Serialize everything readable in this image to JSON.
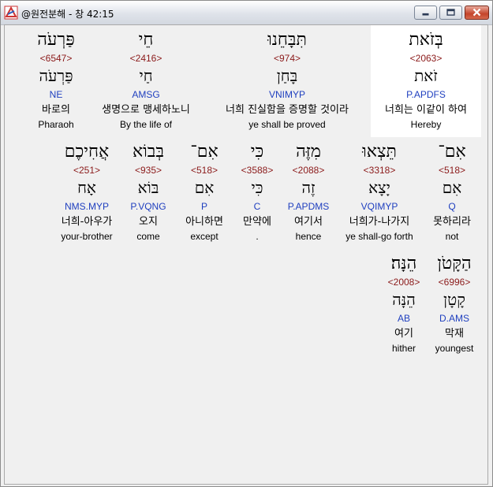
{
  "window": {
    "title": "@원전분해 - 창 42:15"
  },
  "rows": [
    [
      {
        "heb": "פַּרְעֹה",
        "strong": "<6547>",
        "lemma": "פַּרְעֹה",
        "morph": "NE",
        "kor": "바로의",
        "eng": "Pharaoh"
      },
      {
        "heb": "חֵי",
        "strong": "<2416>",
        "lemma": "חַי",
        "morph": "AMSG",
        "kor": "생명으로 맹세하노니",
        "eng": "By the life of"
      },
      {
        "heb": "תִּבָּחֵנוּ",
        "strong": "<974>",
        "lemma": "בָּחַן",
        "morph": "VNIMYP",
        "kor": "너희 진실함을 증명할 것이라",
        "eng": "ye shall be proved"
      },
      {
        "heb": "בְּזֹאת",
        "strong": "<2063>",
        "lemma": "זֹאת",
        "morph": "P.APDFS",
        "kor": "너희는 이같이 하여",
        "eng": "Hereby"
      }
    ],
    [
      {
        "heb": "אֲחִיכֶם",
        "strong": "<251>",
        "lemma": "אָח",
        "morph": "NMS.MYP",
        "kor": "너희-아우가",
        "eng": "your-brother"
      },
      {
        "heb": "בְּבוֹא",
        "strong": "<935>",
        "lemma": "בּוֹא",
        "morph": "P.VQNG",
        "kor": "오지",
        "eng": "come"
      },
      {
        "heb": "אִם־",
        "strong": "<518>",
        "lemma": "אִם",
        "morph": "P",
        "kor": "아니하면",
        "eng": "except"
      },
      {
        "heb": "כִּי",
        "strong": "<3588>",
        "lemma": "כִּי",
        "morph": "C",
        "kor": "만약에",
        "eng": "."
      },
      {
        "heb": "מִזֶּה",
        "strong": "<2088>",
        "lemma": "זֶה",
        "morph": "P.APDMS",
        "kor": "여기서",
        "eng": "hence"
      },
      {
        "heb": "תֵּצְאוּ",
        "strong": "<3318>",
        "lemma": "יָצָא",
        "morph": "VQIMYP",
        "kor": "너희가-나가지",
        "eng": "ye shall-go forth"
      },
      {
        "heb": "אִם־",
        "strong": "<518>",
        "lemma": "אִם",
        "morph": "Q",
        "kor": "못하리라",
        "eng": "not"
      }
    ],
    [
      {
        "heb": "הֵנָּה׃",
        "strong": "<2008>",
        "lemma": "הֵנָּה",
        "morph": "AB",
        "kor": "여기",
        "eng": "hither"
      },
      {
        "heb": "הַקָּטֹן",
        "strong": "<6996>",
        "lemma": "קָטָן",
        "morph": "D.AMS",
        "kor": "막재",
        "eng": "youngest"
      }
    ]
  ]
}
